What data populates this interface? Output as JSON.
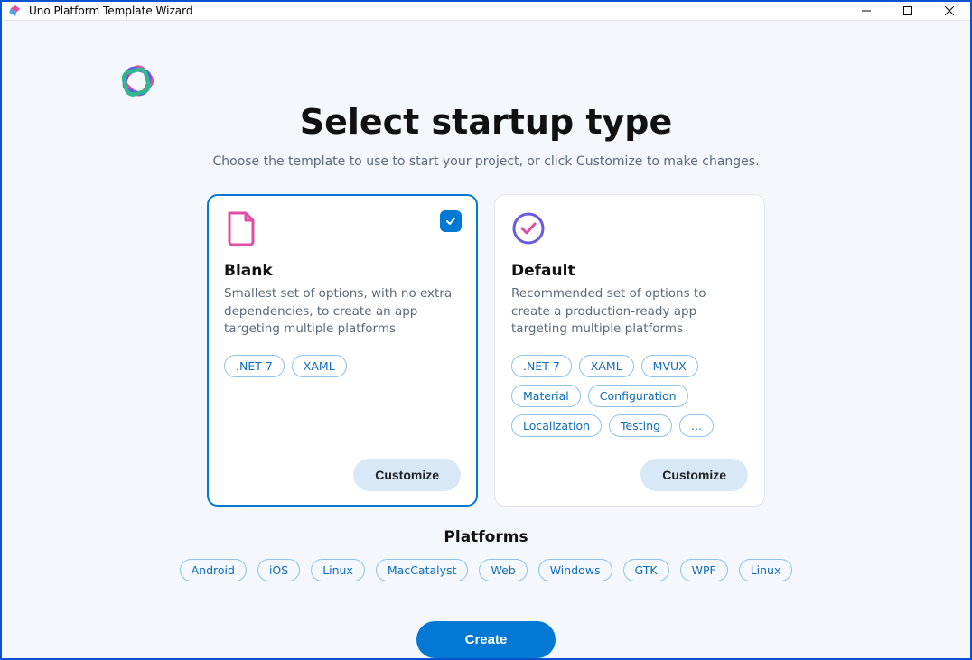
{
  "window": {
    "title": "Uno Platform Template Wizard"
  },
  "page": {
    "heading": "Select startup type",
    "subtitle": "Choose the template to use to start your project, or click Customize to make changes."
  },
  "cards": {
    "blank": {
      "title": "Blank",
      "description": "Smallest set of options, with no extra dependencies, to create an app targeting multiple platforms",
      "tags": [
        ".NET 7",
        "XAML"
      ],
      "customize": "Customize",
      "selected": true
    },
    "default": {
      "title": "Default",
      "description": "Recommended set of options to create a production-ready app targeting multiple platforms",
      "tags": [
        ".NET 7",
        "XAML",
        "MVUX",
        "Material",
        "Configuration",
        "Localization",
        "Testing",
        "..."
      ],
      "customize": "Customize",
      "selected": false
    }
  },
  "platforms": {
    "title": "Platforms",
    "items": [
      "Android",
      "iOS",
      "Linux",
      "MacCatalyst",
      "Web",
      "Windows",
      "GTK",
      "WPF",
      "Linux"
    ]
  },
  "actions": {
    "create": "Create"
  }
}
